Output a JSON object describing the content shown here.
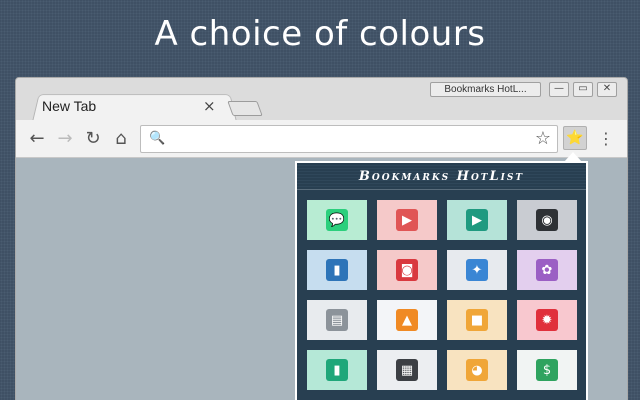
{
  "headline": "A choice of colours",
  "browser": {
    "tab_title": "New Tab",
    "tab_close": "×",
    "app_label": "Bookmarks HotL...",
    "window_minimize": "—",
    "window_restore": "▭",
    "window_close": "✕",
    "back": "←",
    "forward": "→",
    "reload": "↻",
    "home": "⌂",
    "search_icon": "🔍",
    "star": "☆",
    "extension": "⭐",
    "menu": "⋮",
    "address_value": ""
  },
  "popup": {
    "title": "Bookmarks HotList",
    "tiles": [
      {
        "bg": "#b8ecd3",
        "icon_bg": "#2bcf7c",
        "glyph": "💬",
        "icon": "chat-icon"
      },
      {
        "bg": "#f5c9c9",
        "icon_bg": "#e05555",
        "glyph": "▶",
        "icon": "video-icon"
      },
      {
        "bg": "#b5e3d8",
        "icon_bg": "#1f9a80",
        "glyph": "▶",
        "icon": "play-screen-icon"
      },
      {
        "bg": "#c9ccd2",
        "icon_bg": "#2e3135",
        "glyph": "◉",
        "icon": "vinyl-record-icon"
      },
      {
        "bg": "#c6ddef",
        "icon_bg": "#2d74b8",
        "glyph": "▮",
        "icon": "book-icon"
      },
      {
        "bg": "#f5c9c9",
        "icon_bg": "#d9393f",
        "glyph": "◙",
        "icon": "camera-icon"
      },
      {
        "bg": "#e7eaee",
        "icon_bg": "#3a86d4",
        "glyph": "✦",
        "icon": "compass-icon"
      },
      {
        "bg": "#e3cfee",
        "icon_bg": "#9b5fc4",
        "glyph": "✿",
        "icon": "tag-icon"
      },
      {
        "bg": "#e8ebee",
        "icon_bg": "#8c939a",
        "glyph": "▤",
        "icon": "newspaper-icon"
      },
      {
        "bg": "#f3f5f8",
        "icon_bg": "#f08a24",
        "glyph": "▲",
        "icon": "traffic-cone-icon"
      },
      {
        "bg": "#f8e3c0",
        "icon_bg": "#f0a638",
        "glyph": "■",
        "icon": "blocks-icon"
      },
      {
        "bg": "#f8c8cf",
        "icon_bg": "#e0303c",
        "glyph": "✹",
        "icon": "gear-badge-icon"
      },
      {
        "bg": "#b5e8d7",
        "icon_bg": "#1fa77a",
        "glyph": "▮",
        "icon": "notebook-icon"
      },
      {
        "bg": "#eceef1",
        "icon_bg": "#3c3f44",
        "glyph": "▦",
        "icon": "checkered-flag-icon"
      },
      {
        "bg": "#f8e3c0",
        "icon_bg": "#f0a638",
        "glyph": "◕",
        "icon": "cat-face-icon"
      },
      {
        "bg": "#f1f4f3",
        "icon_bg": "#2fa35f",
        "glyph": "$",
        "icon": "money-icon"
      }
    ]
  }
}
